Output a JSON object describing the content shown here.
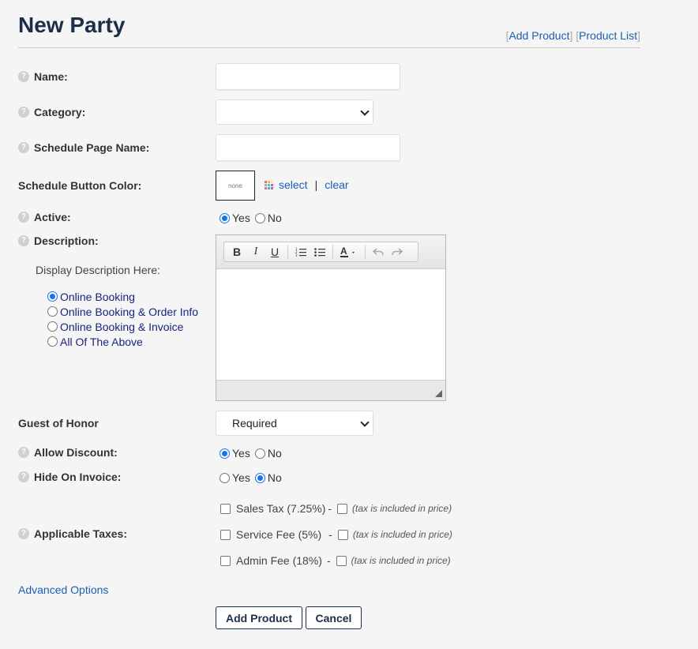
{
  "header": {
    "title": "New Party",
    "links": [
      {
        "label": "Add Product"
      },
      {
        "label": "Product List"
      }
    ]
  },
  "form": {
    "name": {
      "label": "Name:",
      "value": ""
    },
    "category": {
      "label": "Category:",
      "value": ""
    },
    "schedule_page_name": {
      "label": "Schedule Page Name:",
      "value": ""
    },
    "schedule_button_color": {
      "label": "Schedule Button Color:",
      "swatch_text": "none",
      "select_label": "select",
      "separator": "|",
      "clear_label": "clear"
    },
    "active": {
      "label": "Active:",
      "options": [
        "Yes",
        "No"
      ],
      "selected": "Yes"
    },
    "description": {
      "label": "Description:",
      "display_label": "Display Description Here:",
      "display_options": [
        "Online Booking",
        "Online Booking & Order Info",
        "Online Booking & Invoice",
        "All Of The Above"
      ],
      "display_selected": "Online Booking"
    },
    "guest_of_honor": {
      "label": "Guest of Honor",
      "value": "Required"
    },
    "allow_discount": {
      "label": "Allow Discount:",
      "options": [
        "Yes",
        "No"
      ],
      "selected": "Yes"
    },
    "hide_on_invoice": {
      "label": "Hide On Invoice:",
      "options": [
        "Yes",
        "No"
      ],
      "selected": "No"
    },
    "applicable_taxes": {
      "label": "Applicable Taxes:",
      "items": [
        {
          "name": "Sales Tax (7.25%)",
          "dash": "-",
          "note": "(tax is included in price)"
        },
        {
          "name": "Service Fee (5%)",
          "dash": "-",
          "note": "(tax is included in price)"
        },
        {
          "name": "Admin Fee (18%)",
          "dash": "-",
          "note": "(tax is included in price)"
        }
      ]
    }
  },
  "advanced_options_label": "Advanced Options",
  "buttons": {
    "add_product": "Add Product",
    "cancel": "Cancel"
  },
  "icons": {
    "help": "help-circle-icon",
    "palette": "color-palette-icon"
  },
  "colors": {
    "title": "#1c2e4a",
    "link": "#1a5fb4",
    "radio_checked": "#1a73e8",
    "desc_option_text": "#1a237e"
  }
}
